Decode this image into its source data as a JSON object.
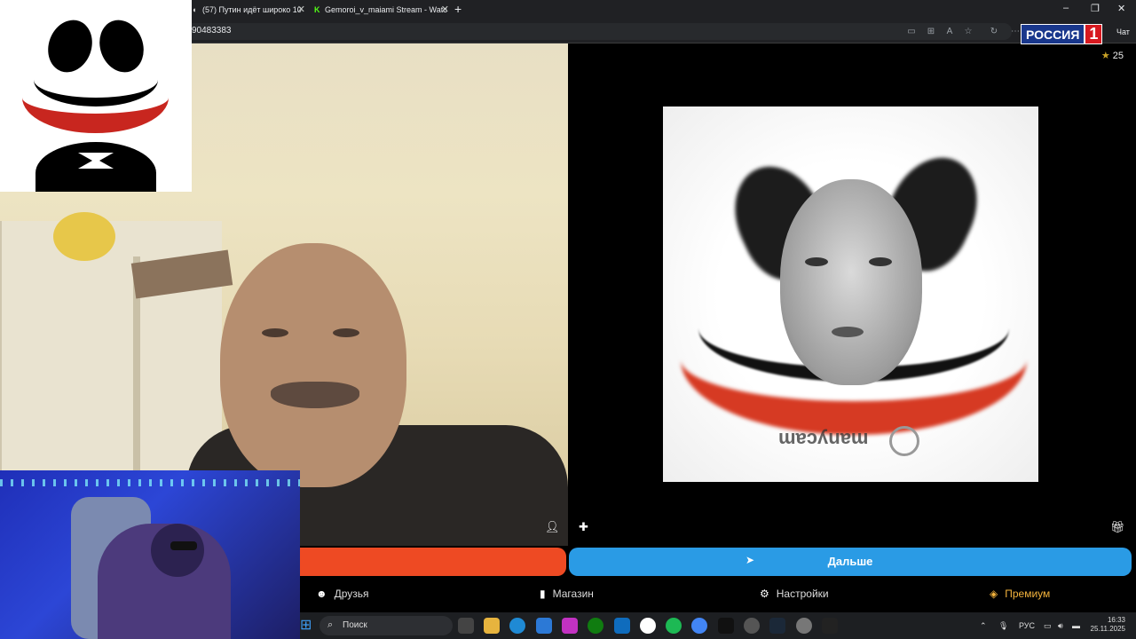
{
  "browser": {
    "tabs": [
      {
        "title": "(57) Путин идёт широко 10",
        "icon": "youtube-icon"
      },
      {
        "title": "Gemoroi_v_maiami Stream - Watc",
        "icon": "kick-icon"
      }
    ],
    "new_tab": "+",
    "url": "90483383",
    "window": {
      "minimize": "–",
      "maximize": "❐",
      "close": "✕"
    },
    "chat_label": "Чат"
  },
  "overlay_logo": {
    "word": "РОССИЯ",
    "number": "1"
  },
  "stars": {
    "count": "25"
  },
  "watermark": "manycam",
  "controls": {
    "next_label": "Дальше"
  },
  "menu": {
    "friends": "Друзья",
    "shop": "Магазин",
    "settings": "Настройки",
    "premium": "Премиум"
  },
  "taskbar": {
    "search_placeholder": "Поиск",
    "lang": "РУС",
    "time": "16:33",
    "date": "25.11.2025"
  },
  "colors": {
    "stop_button": "#ee4a23",
    "next_button": "#2a9be5",
    "premium": "#f4b43d"
  }
}
